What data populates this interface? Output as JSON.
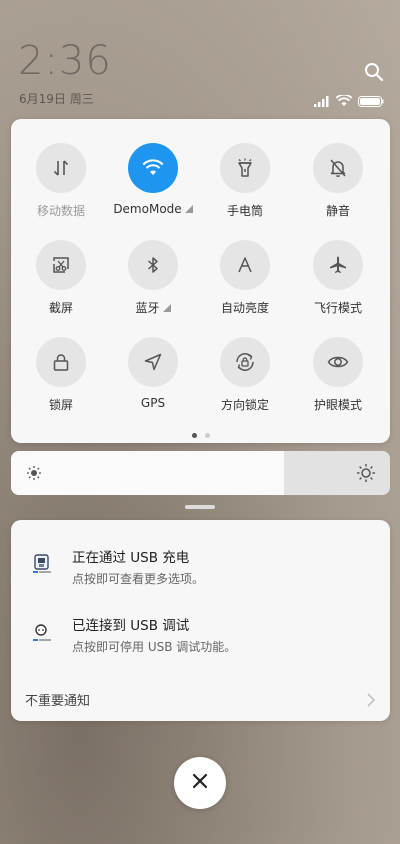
{
  "status": {
    "time": "2:36",
    "date": "6月19日 周三"
  },
  "tiles": [
    {
      "label": "移动数据",
      "icon": "mobile-data-icon",
      "active": false,
      "dim": true
    },
    {
      "label": "DemoMode",
      "icon": "wifi-icon",
      "active": true,
      "dim": false,
      "triangle": true
    },
    {
      "label": "手电筒",
      "icon": "flashlight-icon",
      "active": false
    },
    {
      "label": "静音",
      "icon": "mute-bell-icon",
      "active": false
    },
    {
      "label": "截屏",
      "icon": "screenshot-icon",
      "active": false
    },
    {
      "label": "蓝牙",
      "icon": "bluetooth-icon",
      "active": false,
      "triangle": true
    },
    {
      "label": "自动亮度",
      "icon": "auto-brightness-icon",
      "active": false
    },
    {
      "label": "飞行模式",
      "icon": "airplane-icon",
      "active": false
    },
    {
      "label": "锁屏",
      "icon": "lock-icon",
      "active": false
    },
    {
      "label": "GPS",
      "icon": "gps-icon",
      "active": false
    },
    {
      "label": "方向锁定",
      "icon": "rotation-lock-icon",
      "active": false
    },
    {
      "label": "护眼模式",
      "icon": "eye-icon",
      "active": false
    }
  ],
  "brightness": {
    "level": 0.72
  },
  "notifications": [
    {
      "title": "正在通过 USB 充电",
      "subtitle": "点按即可查看更多选项。",
      "icon": "usb-charge-icon"
    },
    {
      "title": "已连接到 USB 调试",
      "subtitle": "点按即可停用 USB 调试功能。",
      "icon": "usb-debug-icon"
    }
  ],
  "footer": {
    "label": "不重要通知"
  },
  "colors": {
    "accent": "#1e96f0"
  }
}
